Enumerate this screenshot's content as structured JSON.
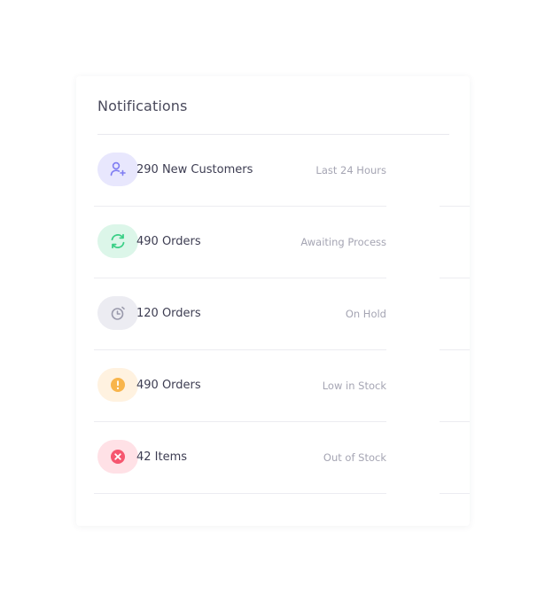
{
  "card": {
    "title": "Notifications"
  },
  "notifications": [
    {
      "title": "290 New Customers",
      "meta": "Last 24 Hours",
      "icon": "user-add-icon",
      "bg": "#e8e7fd",
      "color": "#7f7df2"
    },
    {
      "title": "490 Orders",
      "meta": "Awaiting Process",
      "icon": "refresh-icon",
      "bg": "#dcf6e9",
      "color": "#3bcf86"
    },
    {
      "title": "120 Orders",
      "meta": "On Hold",
      "icon": "timer-icon",
      "bg": "#ececf2",
      "color": "#9a9aac"
    },
    {
      "title": "490 Orders",
      "meta": "Low in Stock",
      "icon": "alert-icon",
      "bg": "#fff2e0",
      "color": "#f8b54c"
    },
    {
      "title": "42 Items",
      "meta": "Out of Stock",
      "icon": "close-circle-icon",
      "bg": "#ffe1e6",
      "color": "#f6566f"
    }
  ]
}
